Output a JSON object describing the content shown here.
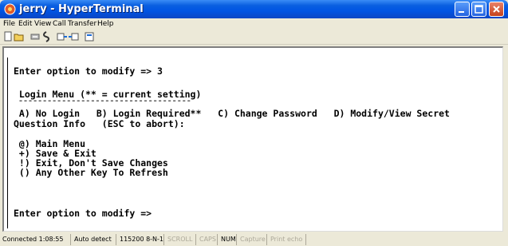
{
  "window": {
    "title": "jerry - HyperTerminal"
  },
  "menu": [
    "File",
    "Edit",
    "View",
    "Call",
    "Transfer",
    "Help"
  ],
  "terminal": {
    "lines": [
      "Enter option to modify => 3",
      " Login Menu (** = current setting)",
      " ------------------------------------",
      " A) No Login   B) Login Required**   C) Change Password   D) Modify/View Secret",
      "Question Info   (ESC to abort):",
      " @) Main Menu",
      " +) Save & Exit",
      " !) Exit, Don't Save Changes",
      " () Any Other Key To Refresh",
      "Enter option to modify =>"
    ]
  },
  "status": {
    "connected": "Connected 1:08:55",
    "detect": "Auto detect",
    "settings": "115200 8-N-1",
    "scroll": "SCROLL",
    "caps": "CAPS",
    "num": "NUM",
    "capture": "Capture",
    "printecho": "Print echo"
  }
}
